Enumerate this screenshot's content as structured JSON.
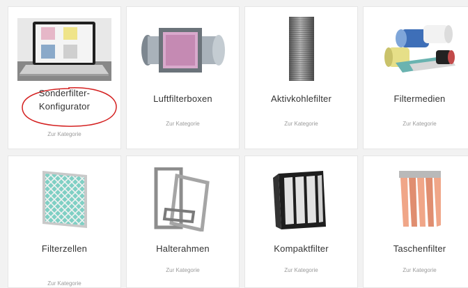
{
  "cards": [
    {
      "title_line1": "Sonderfilter-",
      "title_line2": "Konfigurator",
      "link": "Zur Kategorie",
      "icon": "laptop-filter-icon",
      "annotated": true
    },
    {
      "title": "Luftfilterboxen",
      "link": "Zur Kategorie",
      "icon": "air-filter-box-icon"
    },
    {
      "title": "Aktivkohlefilter",
      "link": "Zur Kategorie",
      "icon": "activated-carbon-cylinder-icon"
    },
    {
      "title": "Filtermedien",
      "link": "Zur Kategorie",
      "icon": "filter-media-rolls-icon"
    },
    {
      "title": "Filterzellen",
      "link": "Zur Kategorie",
      "icon": "panel-filter-icon"
    },
    {
      "title": "Halterahmen",
      "link": "Zur Kategorie",
      "icon": "holding-frame-icon"
    },
    {
      "title": "Kompaktfilter",
      "link": "Zur Kategorie",
      "icon": "compact-filter-icon"
    },
    {
      "title": "Taschenfilter",
      "link": "Zur Kategorie",
      "icon": "bag-filter-icon"
    }
  ],
  "colors": {
    "annotation": "#d42020",
    "background": "#f2f2f2",
    "card": "#ffffff"
  }
}
